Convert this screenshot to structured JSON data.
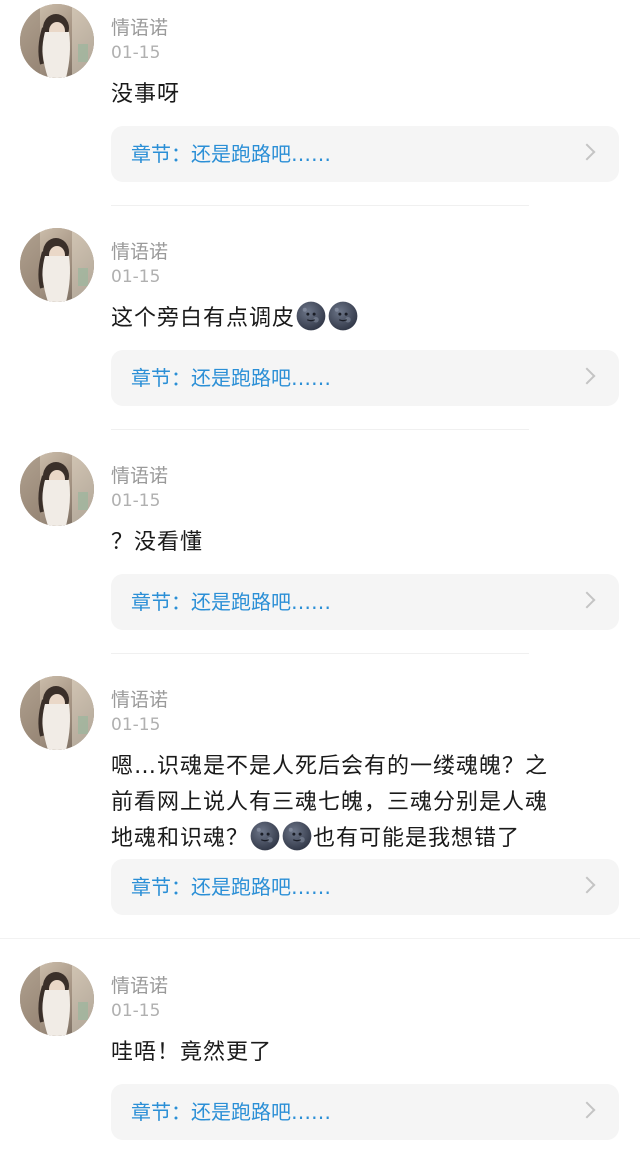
{
  "comments": [
    {
      "username": "情语诺",
      "date": "01-15",
      "lines": [
        "没事呀"
      ],
      "chapter": "章节：还是跑路吧……"
    },
    {
      "username": "情语诺",
      "date": "01-15",
      "lines": [
        "这个旁白有点调皮"
      ],
      "emoji": [
        "new-moon-face",
        "new-moon-face"
      ],
      "chapter": "章节：还是跑路吧……"
    },
    {
      "username": "情语诺",
      "date": "01-15",
      "lines": [
        "？没看懂"
      ],
      "chapter": "章节：还是跑路吧……"
    },
    {
      "username": "情语诺",
      "date": "01-15",
      "lines": [
        "嗯…识魂是不是人死后会有的一缕魂魄？之",
        "前看网上说人有三魂七魄，三魂分别是人魂",
        "地魂和识魂？",
        "也有可能是我想错了"
      ],
      "emoji": [
        "new-moon-face",
        "new-moon-face"
      ],
      "chapter": "章节：还是跑路吧……"
    },
    {
      "username": "情语诺",
      "date": "01-15",
      "lines": [
        "哇唔！竟然更了"
      ],
      "chapter": "章节：还是跑路吧……"
    }
  ],
  "colors": {
    "link": "#2b8fd6",
    "username": "#9a9a9a",
    "date": "#b0b0b0",
    "text": "#1a1a1a",
    "card": "#f5f5f5"
  },
  "icons": {
    "avatar": "user-avatar",
    "emoji": "new-moon-face",
    "chevron": "chevron-right-icon"
  }
}
